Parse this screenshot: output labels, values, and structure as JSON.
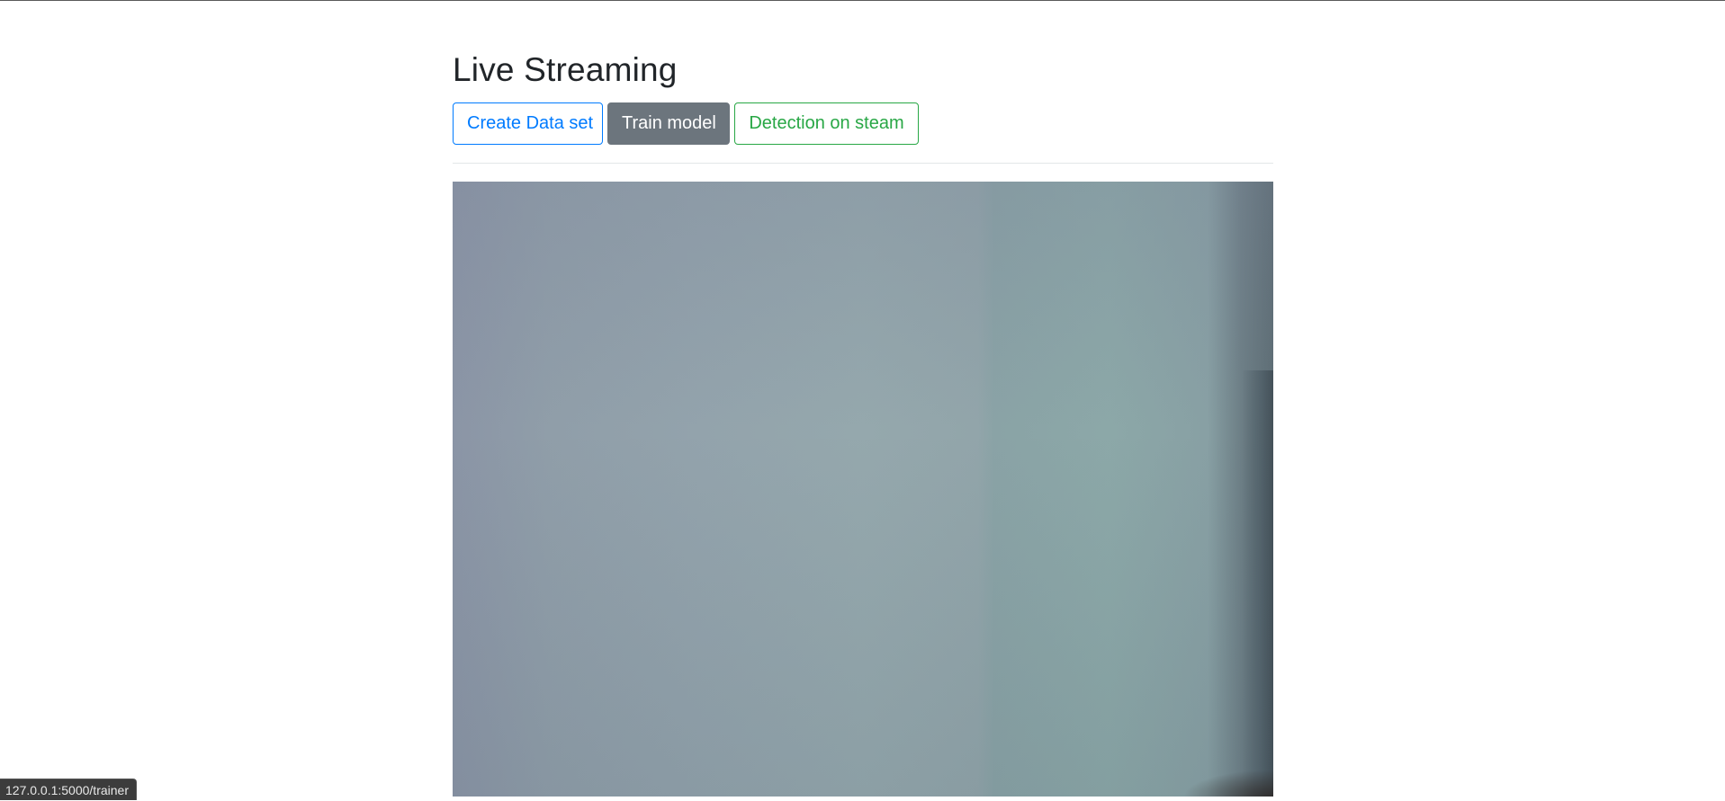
{
  "page": {
    "title": "Live Streaming"
  },
  "actions": {
    "create_dataset_label": "Create Data set",
    "train_model_label": "Train model",
    "detection_label": "Detection on steam"
  },
  "stream": {
    "content": "live-camera-feed"
  },
  "status_bar": {
    "url": "127.0.0.1:5000/trainer"
  },
  "colors": {
    "primary": "#007bff",
    "secondary": "#6c757d",
    "success": "#28a745",
    "text": "#212529"
  }
}
